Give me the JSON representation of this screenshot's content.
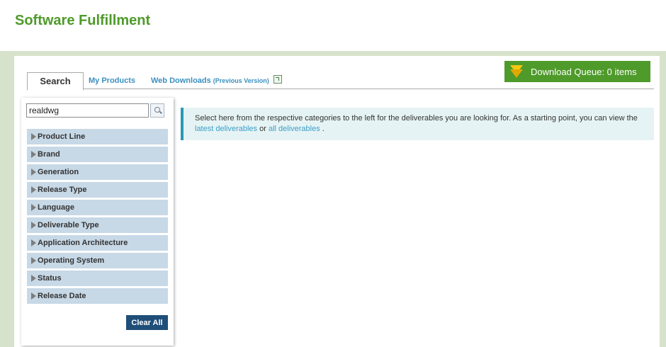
{
  "header": {
    "title": "Software Fulfillment"
  },
  "tabs": [
    {
      "label": "Search",
      "active": true
    },
    {
      "label": "My Products"
    },
    {
      "label": "Web Downloads",
      "note": "(Previous Version)"
    }
  ],
  "queue": {
    "label": "Download Queue: 0 items"
  },
  "search": {
    "value": "realdwg",
    "icon": "magnifier-icon"
  },
  "filters": [
    "Product Line",
    "Brand",
    "Generation",
    "Release Type",
    "Language",
    "Deliverable Type",
    "Application Architecture",
    "Operating System",
    "Status",
    "Release Date"
  ],
  "clear_label": "Clear All",
  "info": {
    "text_start": "Select here from the respective categories to the left for the deliverables you are looking for. As a starting point, you can view the",
    "link_latest": "latest deliverables",
    "text_or": "or",
    "link_all": "all deliverables",
    "text_end": "."
  },
  "colors": {
    "brand_green": "#4e9a2a",
    "filter_bg": "#c7d8e6",
    "button_navy": "#1f4e79",
    "info_accent": "#2a9ab4",
    "link": "#3a9fc9"
  }
}
